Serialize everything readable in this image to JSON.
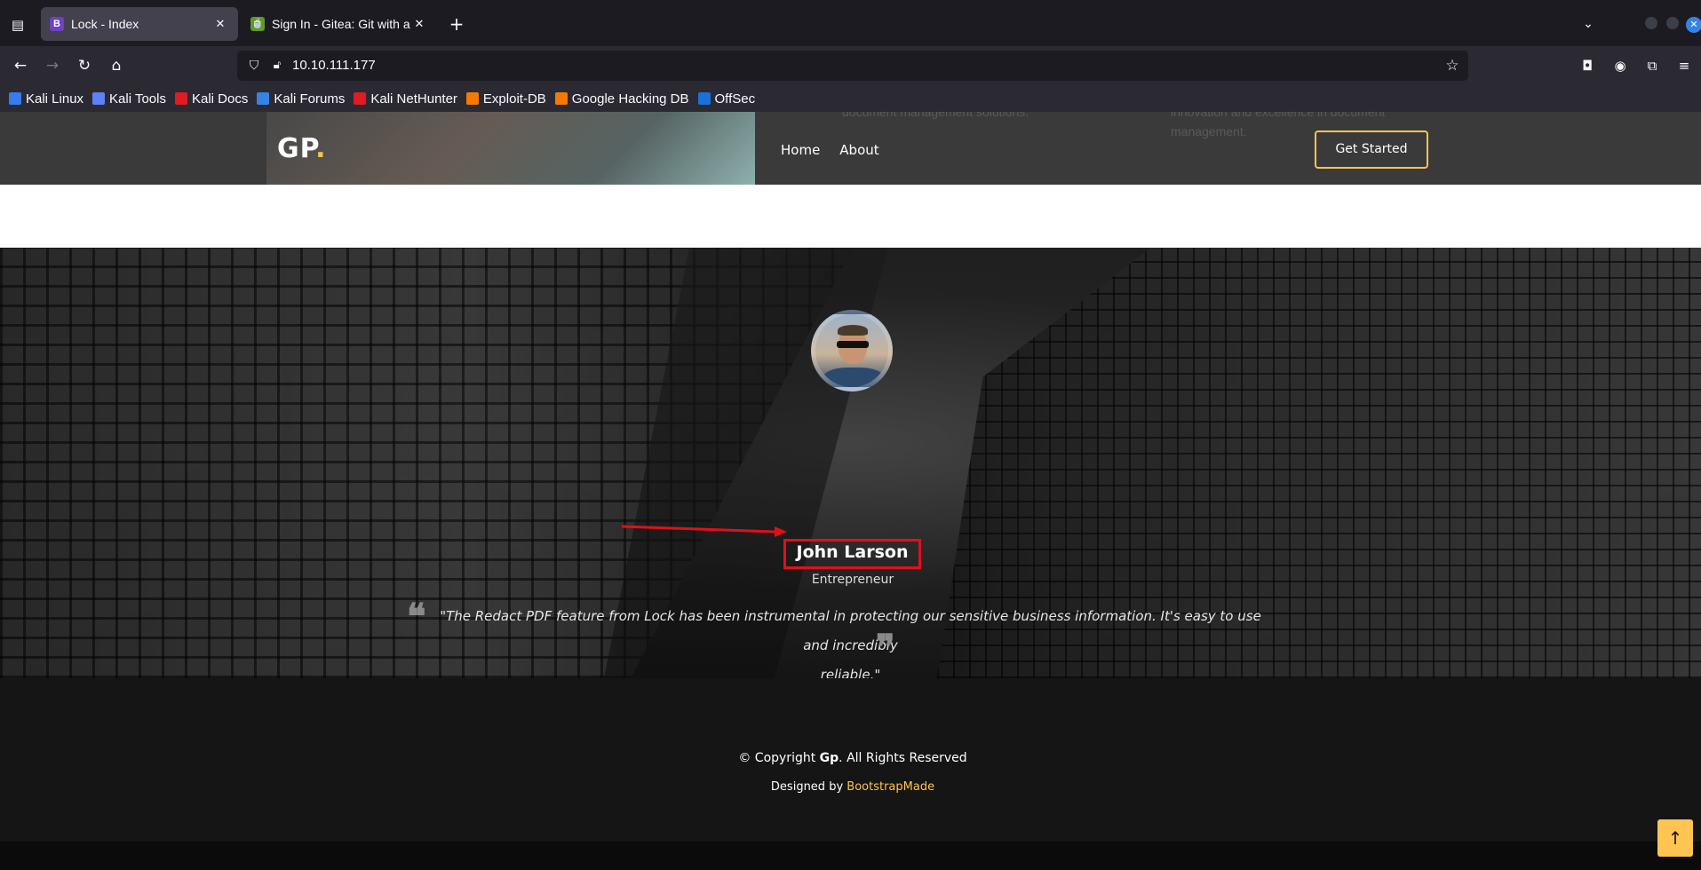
{
  "browser": {
    "tabs": [
      {
        "title": "Lock - Index",
        "favicon": "B",
        "active": true
      },
      {
        "title": "Sign In - Gitea: Git with a",
        "favicon": "gitea-icon",
        "active": false
      }
    ],
    "url": "10.10.111.177",
    "bookmarks": [
      {
        "label": "Kali Linux",
        "icon": "kali-dragon-icon",
        "color": "#367bf0"
      },
      {
        "label": "Kali Tools",
        "icon": "kali-tools-icon",
        "color": "#5e81f4"
      },
      {
        "label": "Kali Docs",
        "icon": "kali-docs-icon",
        "color": "#e01b24"
      },
      {
        "label": "Kali Forums",
        "icon": "kali-forums-icon",
        "color": "#3584e4"
      },
      {
        "label": "Kali NetHunter",
        "icon": "nethunter-icon",
        "color": "#e01b24"
      },
      {
        "label": "Exploit-DB",
        "icon": "exploit-db-icon",
        "color": "#f57900"
      },
      {
        "label": "Google Hacking DB",
        "icon": "ghdb-icon",
        "color": "#f57900"
      },
      {
        "label": "OffSec",
        "icon": "offsec-icon",
        "color": "#1c71d8"
      }
    ]
  },
  "site": {
    "logo_text": "GP",
    "logo_dot": ".",
    "header_fade_left": "document management solutions.",
    "header_fade_right_1": "innovation and excellence in document",
    "header_fade_right_2": "management.",
    "nav": [
      {
        "label": "Home"
      },
      {
        "label": "About"
      }
    ],
    "cta": "Get Started",
    "accent": "#ffc451"
  },
  "testimonial": {
    "name": "John Larson",
    "role": "Entrepreneur",
    "quote_line1": "\"The Redact PDF feature from Lock has been instrumental in protecting our sensitive business information. It's easy to use and incredibly",
    "quote_line2": "reliable.\"",
    "slides_total": 3,
    "slide_active": 3,
    "annotation_color": "#e0101a"
  },
  "footer": {
    "copyright_prefix": "© Copyright ",
    "copyright_brand": "Gp",
    "copyright_suffix": ". All Rights Reserved",
    "designed_prefix": "Designed by ",
    "designed_link": "BootstrapMade"
  }
}
